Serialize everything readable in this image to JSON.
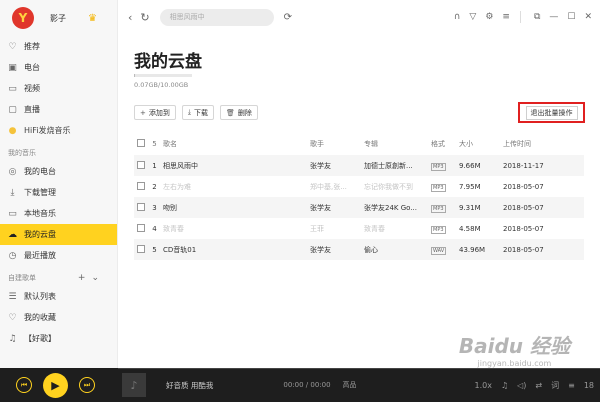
{
  "user": {
    "name": "影子",
    "avatar_letter": "Y",
    "vip_icon": "crown-icon"
  },
  "sidebar": {
    "top_items": [
      {
        "label": "推荐",
        "icon": "heart-icon"
      },
      {
        "label": "电台",
        "icon": "radio-icon"
      },
      {
        "label": "视频",
        "icon": "video-icon"
      },
      {
        "label": "直播",
        "icon": "live-icon"
      },
      {
        "label": "HiFi发烧音乐",
        "icon": "hifi-icon"
      }
    ],
    "my_music_heading": "我的音乐",
    "my_items": [
      {
        "label": "我的电台",
        "icon": "radio-icon"
      },
      {
        "label": "下载管理",
        "icon": "download-icon"
      },
      {
        "label": "本地音乐",
        "icon": "monitor-icon"
      },
      {
        "label": "我的云盘",
        "icon": "cloud-icon",
        "active": true
      },
      {
        "label": "最近播放",
        "icon": "clock-icon"
      }
    ],
    "playlist_heading": "自建歌单",
    "playlists": [
      {
        "label": "默认列表",
        "icon": "list-icon"
      },
      {
        "label": "我的收藏",
        "icon": "heart-outline-icon"
      },
      {
        "label": "【好歌】",
        "icon": "playlist-icon"
      }
    ]
  },
  "topbar": {
    "search_placeholder": "相思风雨中"
  },
  "page": {
    "title": "我的云盘",
    "usage_text": "0.07GB/10.00GB",
    "usage_fraction": 0.007
  },
  "toolbar": {
    "add_label": "添加到",
    "download_label": "下载",
    "delete_label": "删除",
    "exit_batch_label": "退出批量操作"
  },
  "table": {
    "count": "5",
    "headers": {
      "name": "歌名",
      "artist": "歌手",
      "album": "专辑",
      "format": "格式",
      "size": "大小",
      "date": "上传时间"
    },
    "rows": [
      {
        "num": "1",
        "name": "相思风雨中",
        "artist": "张学友",
        "album": "加德士原創新...",
        "format": "MP3",
        "size": "9.66M",
        "date": "2018-11-17",
        "grey": false
      },
      {
        "num": "2",
        "name": "左右为难",
        "artist": "郑中基,张...",
        "album": "忘记你我做不到",
        "format": "MP3",
        "size": "7.95M",
        "date": "2018-05-07",
        "grey": true
      },
      {
        "num": "3",
        "name": "吻别",
        "artist": "张学友",
        "album": "张学友24K Go...",
        "format": "MP3",
        "size": "9.31M",
        "date": "2018-05-07",
        "grey": false
      },
      {
        "num": "4",
        "name": "致青春",
        "artist": "王菲",
        "album": "致青春",
        "format": "MP3",
        "size": "4.58M",
        "date": "2018-05-07",
        "grey": true
      },
      {
        "num": "5",
        "name": "CD音轨01",
        "artist": "张学友",
        "album": "偷心",
        "format": "WAV",
        "size": "43.96M",
        "date": "2018-05-07",
        "grey": false
      }
    ]
  },
  "player": {
    "title": "好音质 用酷我",
    "time": "00:00 / 00:00",
    "quality": "高品",
    "speed": "1.0x",
    "count": "18"
  },
  "watermark": {
    "big": "Baidu 经验",
    "small": "jingyan.baidu.com"
  }
}
